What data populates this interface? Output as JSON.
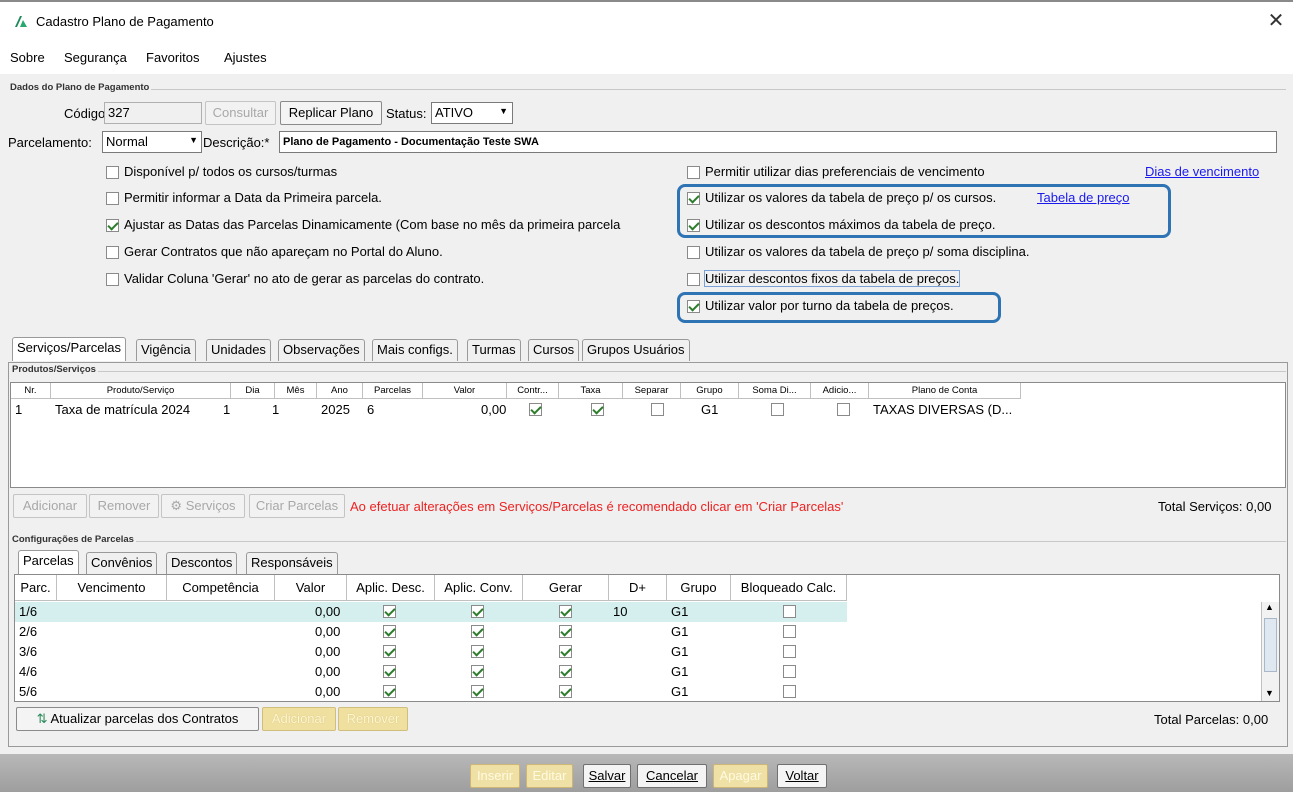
{
  "window": {
    "title": "Cadastro Plano de Pagamento",
    "close": "✕"
  },
  "menu": [
    "Sobre",
    "Segurança",
    "Favoritos",
    "Ajustes"
  ],
  "header": {
    "group_title": "Dados do Plano de Pagamento",
    "codigo_label": "Código:",
    "codigo_value": "327",
    "consultar": "Consultar",
    "replicar": "Replicar Plano",
    "status_label": "Status:",
    "status_value": "ATIVO",
    "parcelamento_label": "Parcelamento:",
    "parcelamento_value": "Normal",
    "descricao_label": "Descrição:*",
    "descricao_value": "Plano de Pagamento - Documentação Teste SWA"
  },
  "options_left": [
    {
      "label": "Disponível p/ todos os cursos/turmas",
      "checked": false
    },
    {
      "label": "Permitir informar a Data da Primeira parcela.",
      "checked": false
    },
    {
      "label": "Ajustar as Datas das Parcelas Dinamicamente (Com base no mês da primeira parcela",
      "checked": true
    },
    {
      "label": "Gerar Contratos que não apareçam no Portal do Aluno.",
      "checked": false
    },
    {
      "label": "Validar Coluna 'Gerar' no ato de gerar as parcelas do contrato.",
      "checked": false
    }
  ],
  "options_right": [
    {
      "label": "Permitir utilizar dias preferenciais de vencimento",
      "checked": false
    },
    {
      "label": "Utilizar os valores da tabela de preço p/ os cursos.",
      "checked": true
    },
    {
      "label": "Utilizar os descontos máximos da tabela de preço.",
      "checked": true
    },
    {
      "label": "Utilizar os valores da tabela de preço p/ soma disciplina.",
      "checked": false
    },
    {
      "label": "Utilizar descontos fixos da tabela de preços.",
      "checked": false
    },
    {
      "label": "Utilizar valor por turno da tabela de preços.",
      "checked": true
    }
  ],
  "links": {
    "dias_vencimento": "Dias de vencimento",
    "tabela_preco": "Tabela de preço"
  },
  "tabs": [
    "Serviços/Parcelas",
    "Vigência",
    "Unidades",
    "Observações",
    "Mais configs.",
    "Turmas",
    "Cursos",
    "Grupos Usuários"
  ],
  "produtos": {
    "group_title": "Produtos/Serviços",
    "headers": [
      "Nr.",
      "Produto/Serviço",
      "Dia",
      "Mês",
      "Ano",
      "Parcelas",
      "Valor",
      "Contr...",
      "Taxa",
      "Separar",
      "Grupo",
      "Soma Di...",
      "Adicio...",
      "Plano de Conta"
    ],
    "rows": [
      {
        "nr": "1",
        "produto": "Taxa de matrícula 2024",
        "dia": "1",
        "mes": "1",
        "ano": "2025",
        "parcelas": "6",
        "valor": "0,00",
        "contr": true,
        "taxa": true,
        "separar": false,
        "grupo": "G1",
        "soma": false,
        "adicio": false,
        "plano": "TAXAS DIVERSAS (D..."
      }
    ],
    "buttons": {
      "adicionar": "Adicionar",
      "remover": "Remover",
      "servicos": "Serviços",
      "criar": "Criar Parcelas"
    },
    "warning": "Ao efetuar alterações em Serviços/Parcelas é recomendado clicar em 'Criar Parcelas'",
    "total": "Total Serviços: 0,00"
  },
  "config": {
    "group_title": "Configurações de Parcelas",
    "tabs": [
      "Parcelas",
      "Convênios",
      "Descontos",
      "Responsáveis"
    ],
    "headers": [
      "Parc.",
      "Vencimento",
      "Competência",
      "Valor",
      "Aplic. Desc.",
      "Aplic. Conv.",
      "Gerar",
      "D+",
      "Grupo",
      "Bloqueado Calc."
    ],
    "rows": [
      {
        "parc": "1/6",
        "valor": "0,00",
        "d": "10",
        "grupo": "G1"
      },
      {
        "parc": "2/6",
        "valor": "0,00",
        "d": "",
        "grupo": "G1"
      },
      {
        "parc": "3/6",
        "valor": "0,00",
        "d": "",
        "grupo": "G1"
      },
      {
        "parc": "4/6",
        "valor": "0,00",
        "d": "",
        "grupo": "G1"
      },
      {
        "parc": "5/6",
        "valor": "0,00",
        "d": "",
        "grupo": "G1"
      }
    ],
    "buttons": {
      "atualizar": "Atualizar parcelas dos Contratos",
      "adicionar": "Adicionar",
      "remover": "Remover"
    },
    "total": "Total Parcelas: 0,00"
  },
  "footer": [
    "Inserir",
    "Editar",
    "Salvar",
    "Cancelar",
    "Apagar",
    "Voltar"
  ]
}
